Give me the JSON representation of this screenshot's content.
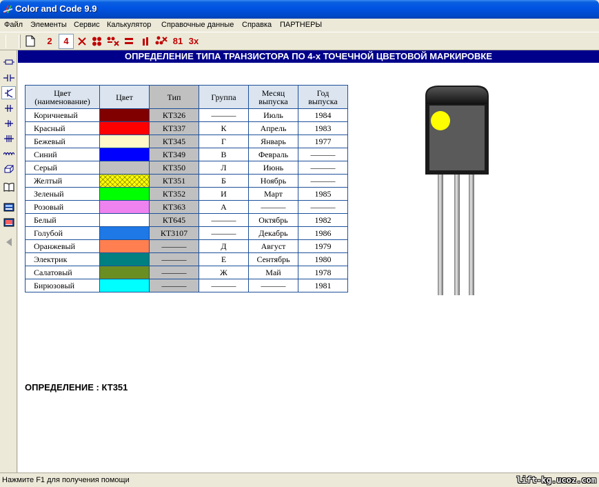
{
  "window": {
    "title": "Color and Code 9.9"
  },
  "menu": [
    "Файл",
    "Элементы",
    "Сервис",
    "Калькулятор",
    "Справочные данные",
    "Справка",
    "ПАРТНЕРЫ"
  ],
  "toolbar": {
    "buttons": [
      {
        "label": "2",
        "icon": ""
      },
      {
        "label": "4",
        "icon": "",
        "pressed": true
      },
      {
        "label": "",
        "icon": "x-icon"
      },
      {
        "label": "",
        "icon": "four-dots-icon"
      },
      {
        "label": "",
        "icon": "dots-x-icon"
      },
      {
        "label": "",
        "icon": "equals-icon"
      },
      {
        "label": "",
        "icon": "two-bars-icon"
      },
      {
        "label": "",
        "icon": "dots-x-alt-icon"
      },
      {
        "label": "81",
        "icon": ""
      },
      {
        "label": "3x",
        "icon": ""
      }
    ]
  },
  "left_tools": [
    "resistor-icon",
    "capacitor-icon",
    "transistor-icon",
    "inductor-icon",
    "diode-icon",
    "zener-icon",
    "coil-icon",
    "eraser-icon",
    "book-icon",
    "display-icon",
    "display-alt-icon",
    "arrow-left-icon"
  ],
  "header": {
    "title": "ОПРЕДЕЛЕНИЕ ТИПА ТРАНЗИСТОРА ПО 4-х ТОЧЕЧНОЙ ЦВЕТОВОЙ МАРКИРОВКЕ"
  },
  "table": {
    "headers": [
      {
        "line1": "Цвет",
        "line2": "(наименование)"
      },
      {
        "line1": "Цвет",
        "line2": ""
      },
      {
        "line1": "Тип",
        "line2": ""
      },
      {
        "line1": "Группа",
        "line2": ""
      },
      {
        "line1": "Месяц",
        "line2": "выпуска"
      },
      {
        "line1": "Год",
        "line2": "выпуска"
      }
    ],
    "rows": [
      {
        "name": "Коричневый",
        "color": "#800000",
        "type": "КТ326",
        "group": "———",
        "month": "Июль",
        "year": "1984"
      },
      {
        "name": "Красный",
        "color": "#ff0000",
        "type": "КТ337",
        "group": "К",
        "month": "Апрель",
        "year": "1983"
      },
      {
        "name": "Бежевый",
        "color": "#fff8c8",
        "type": "КТ345",
        "group": "Г",
        "month": "Январь",
        "year": "1977"
      },
      {
        "name": "Синий",
        "color": "#0000ff",
        "type": "КТ349",
        "group": "В",
        "month": "Февраль",
        "year": "———"
      },
      {
        "name": "Серый",
        "color": "#c0c0c0",
        "type": "КТ350",
        "group": "Л",
        "month": "Июнь",
        "year": "———"
      },
      {
        "name": "Желтый",
        "color": "#ffff00",
        "type": "КТ351",
        "group": "Б",
        "month": "Ноябрь",
        "year": "———",
        "pattern": true
      },
      {
        "name": "Зеленый",
        "color": "#00ff00",
        "type": "КТ352",
        "group": "И",
        "month": "Март",
        "year": "1985"
      },
      {
        "name": "Розовый",
        "color": "#ee82ee",
        "type": "КТ363",
        "group": "А",
        "month": "———",
        "year": "———"
      },
      {
        "name": "Белый",
        "color": "#ffffff",
        "type": "КТ645",
        "group": "———",
        "month": "Октябрь",
        "year": "1982"
      },
      {
        "name": "Голубой",
        "color": "#1e78e6",
        "type": "КТ3107",
        "group": "———",
        "month": "Декабрь",
        "year": "1986"
      },
      {
        "name": "Оранжевый",
        "color": "#ff7f50",
        "type": "———",
        "group": "Д",
        "month": "Август",
        "year": "1979"
      },
      {
        "name": "Электрик",
        "color": "#008080",
        "type": "———",
        "group": "Е",
        "month": "Сентябрь",
        "year": "1980"
      },
      {
        "name": "Салатовый",
        "color": "#6b8e23",
        "type": "———",
        "group": "Ж",
        "month": "Май",
        "year": "1978"
      },
      {
        "name": "Бирюзовый",
        "color": "#00ffff",
        "type": "———",
        "group": "———",
        "month": "———",
        "year": "1981"
      }
    ]
  },
  "result": {
    "label": "ОПРЕДЕЛЕНИЕ :",
    "value": "КТ351"
  },
  "transistor": {
    "dot_color": "#ffff00"
  },
  "status": {
    "text": "Нажмите F1 для получения помощи",
    "watermark": "lift-kg.ucoz.com"
  }
}
